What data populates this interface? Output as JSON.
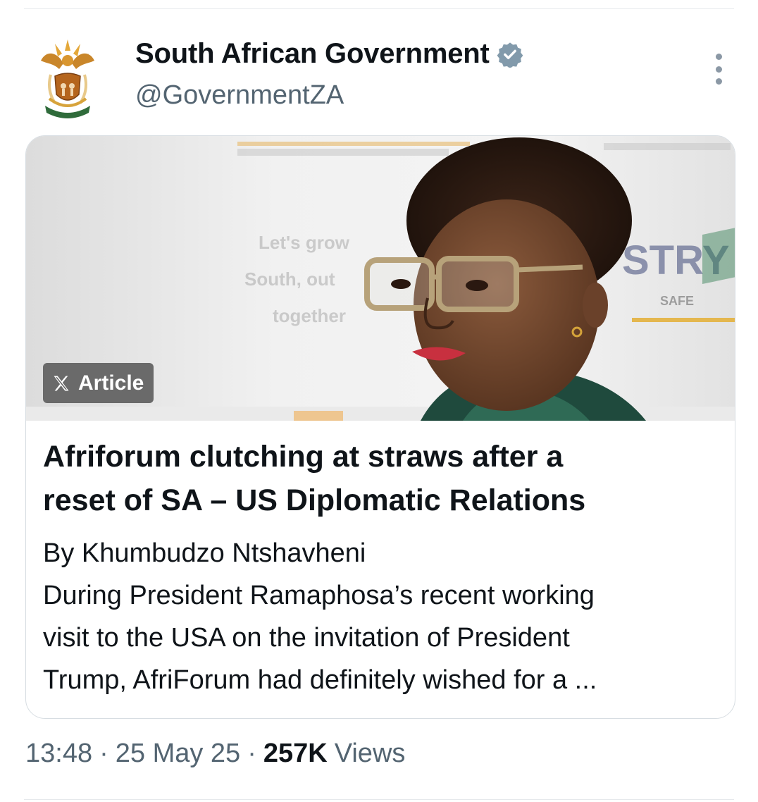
{
  "account": {
    "display_name": "South African Government",
    "handle": "@GovernmentZA",
    "verified_color": "#829aab"
  },
  "article": {
    "badge_label": "Article",
    "headline_line1": "Afriforum clutching at straws after a",
    "headline_line2": "reset of SA – US Diplomatic Relations",
    "byline": "By  Khumbudzo Ntshavheni",
    "excerpt_line1": "During President Ramaphosa’s recent working",
    "excerpt_line2": "visit to the USA on the invitation of President",
    "excerpt_line3": "Trump, AfriForum had definitely wished for a ...",
    "image_backdrop_text": {
      "line1": "Let's grow",
      "line2": "South, out",
      "line3": "together",
      "logo": "STRY",
      "logo_sub": "SAFE"
    }
  },
  "meta": {
    "time": "13:48",
    "separator": "·",
    "date": "25 May 25",
    "views_count": "257K",
    "views_label": "Views"
  },
  "icons": {
    "avatar": "coat-of-arms-icon",
    "verified": "verified-badge-icon",
    "more": "more-options-icon",
    "x_logo": "x-logo-icon"
  }
}
